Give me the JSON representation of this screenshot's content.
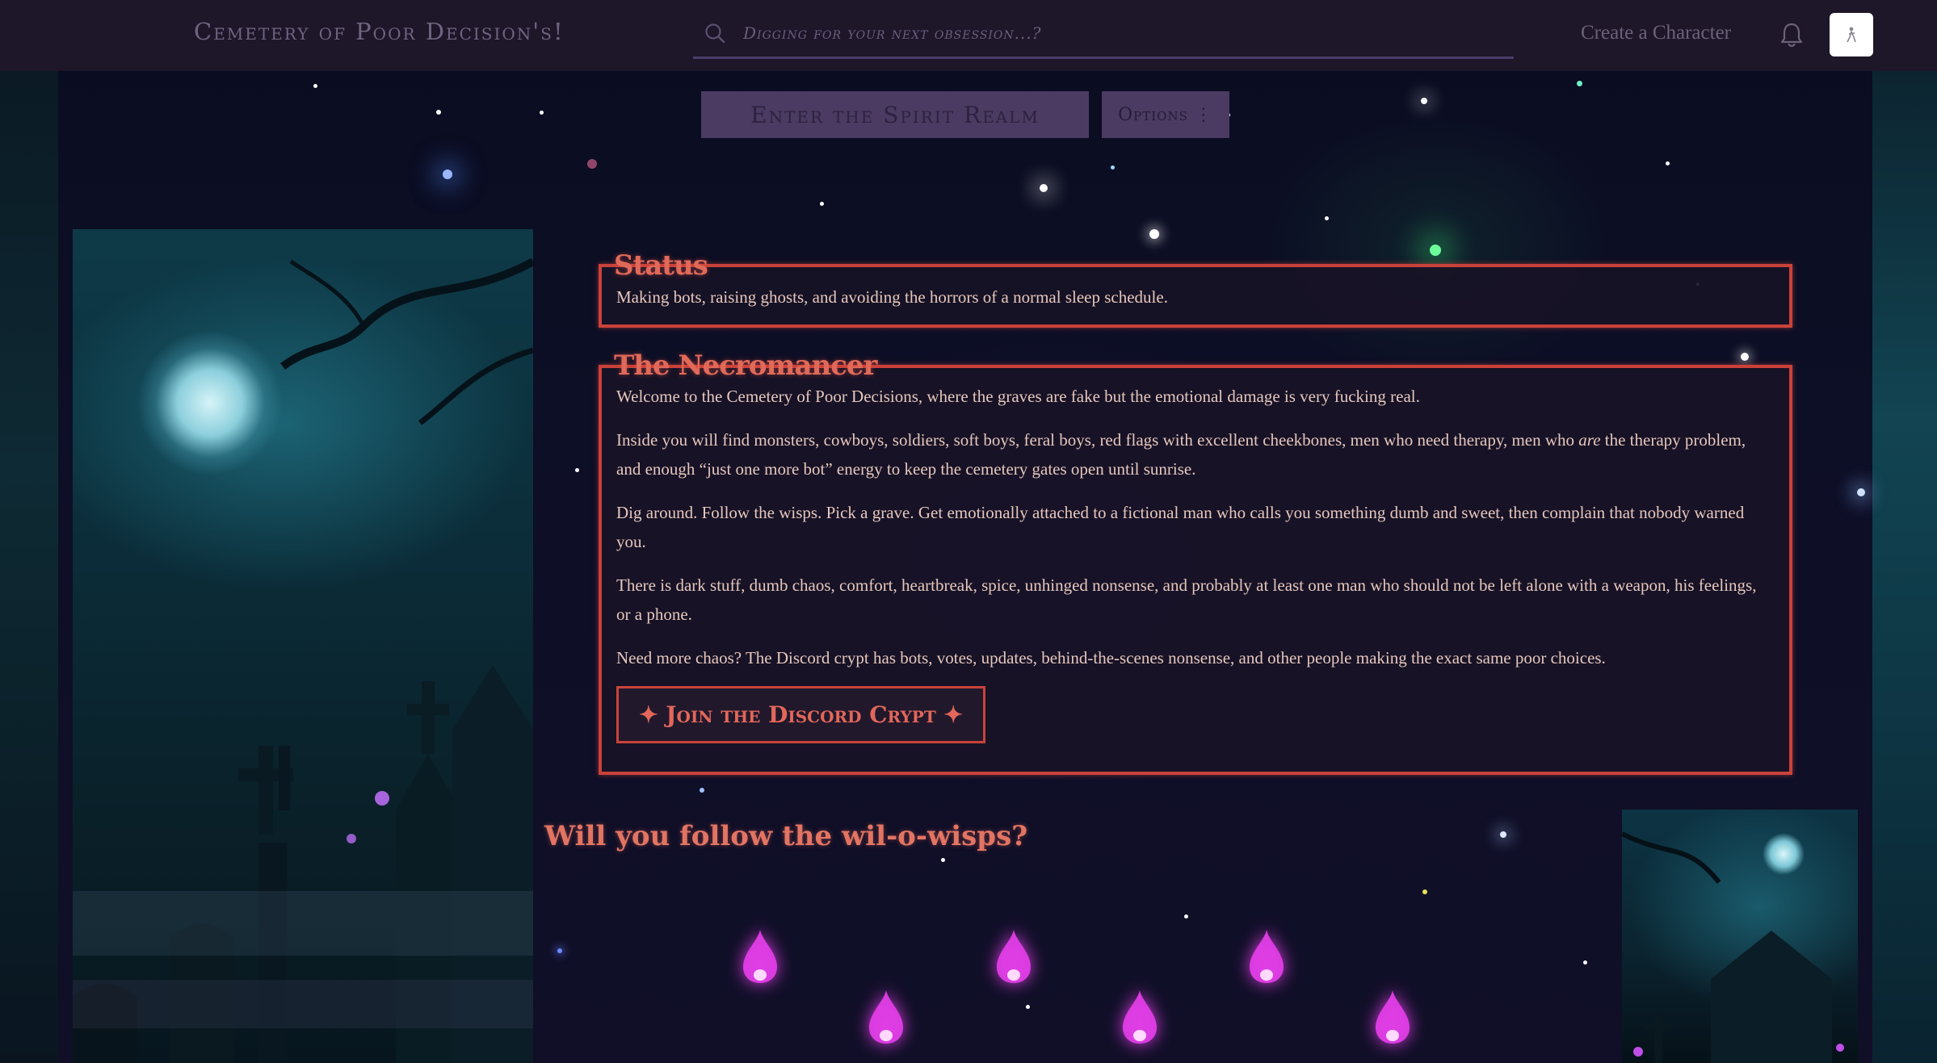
{
  "nav": {
    "brand": "Cemetery of Poor Decision's!",
    "search_placeholder": "Digging for your next obsession...?",
    "create_label": "Create a Character",
    "bell_icon": "bell-icon",
    "avatar_icon": "user-avatar"
  },
  "actions": {
    "spirit_label": "Enter the Spirit Realm",
    "options_label": "Options ⋮"
  },
  "status": {
    "title": "Status",
    "text": "Making bots, raising ghosts, and avoiding the horrors of a normal sleep schedule."
  },
  "necromancer": {
    "title": "The Necromancer",
    "p1": "Welcome to the Cemetery of Poor Decisions, where the graves are fake but the emotional damage is very fucking real.",
    "p2a": "Inside you will find monsters, cowboys, soldiers, soft boys, feral boys, red flags with excellent cheekbones, men who need therapy, men who",
    "p2em": "are",
    "p2b": "the therapy problem,",
    "p2c": "and enough “just one more bot” energy to keep the cemetery gates open until sunrise.",
    "p3a": "Dig around. Follow the wisps. Pick a grave. Get emotionally attached to a fictional man who calls you something dumb and sweet, then complain that nobody warned",
    "p3b": "you.",
    "p4a": "There is dark stuff, dumb chaos, comfort, heartbreak, spice, unhinged nonsense, and probably at least one man who should not be left alone with a weapon, his feelings,",
    "p4b": "or a phone.",
    "p5": "Need more chaos? The Discord crypt has bots, votes, updates, behind-the-scenes nonsense, and other people making the exact same poor choices.",
    "discord_label": "✦ Join the Discord Crypt ✦"
  },
  "wisps": {
    "heading": "Will you follow the wil-o-wisps?",
    "count": 6,
    "color": "#e03ee6"
  },
  "colors": {
    "accent_red": "#c9423a",
    "title_red": "#e06a59",
    "body_text": "#e6c8bd",
    "nav_bg": "#1e1629"
  }
}
